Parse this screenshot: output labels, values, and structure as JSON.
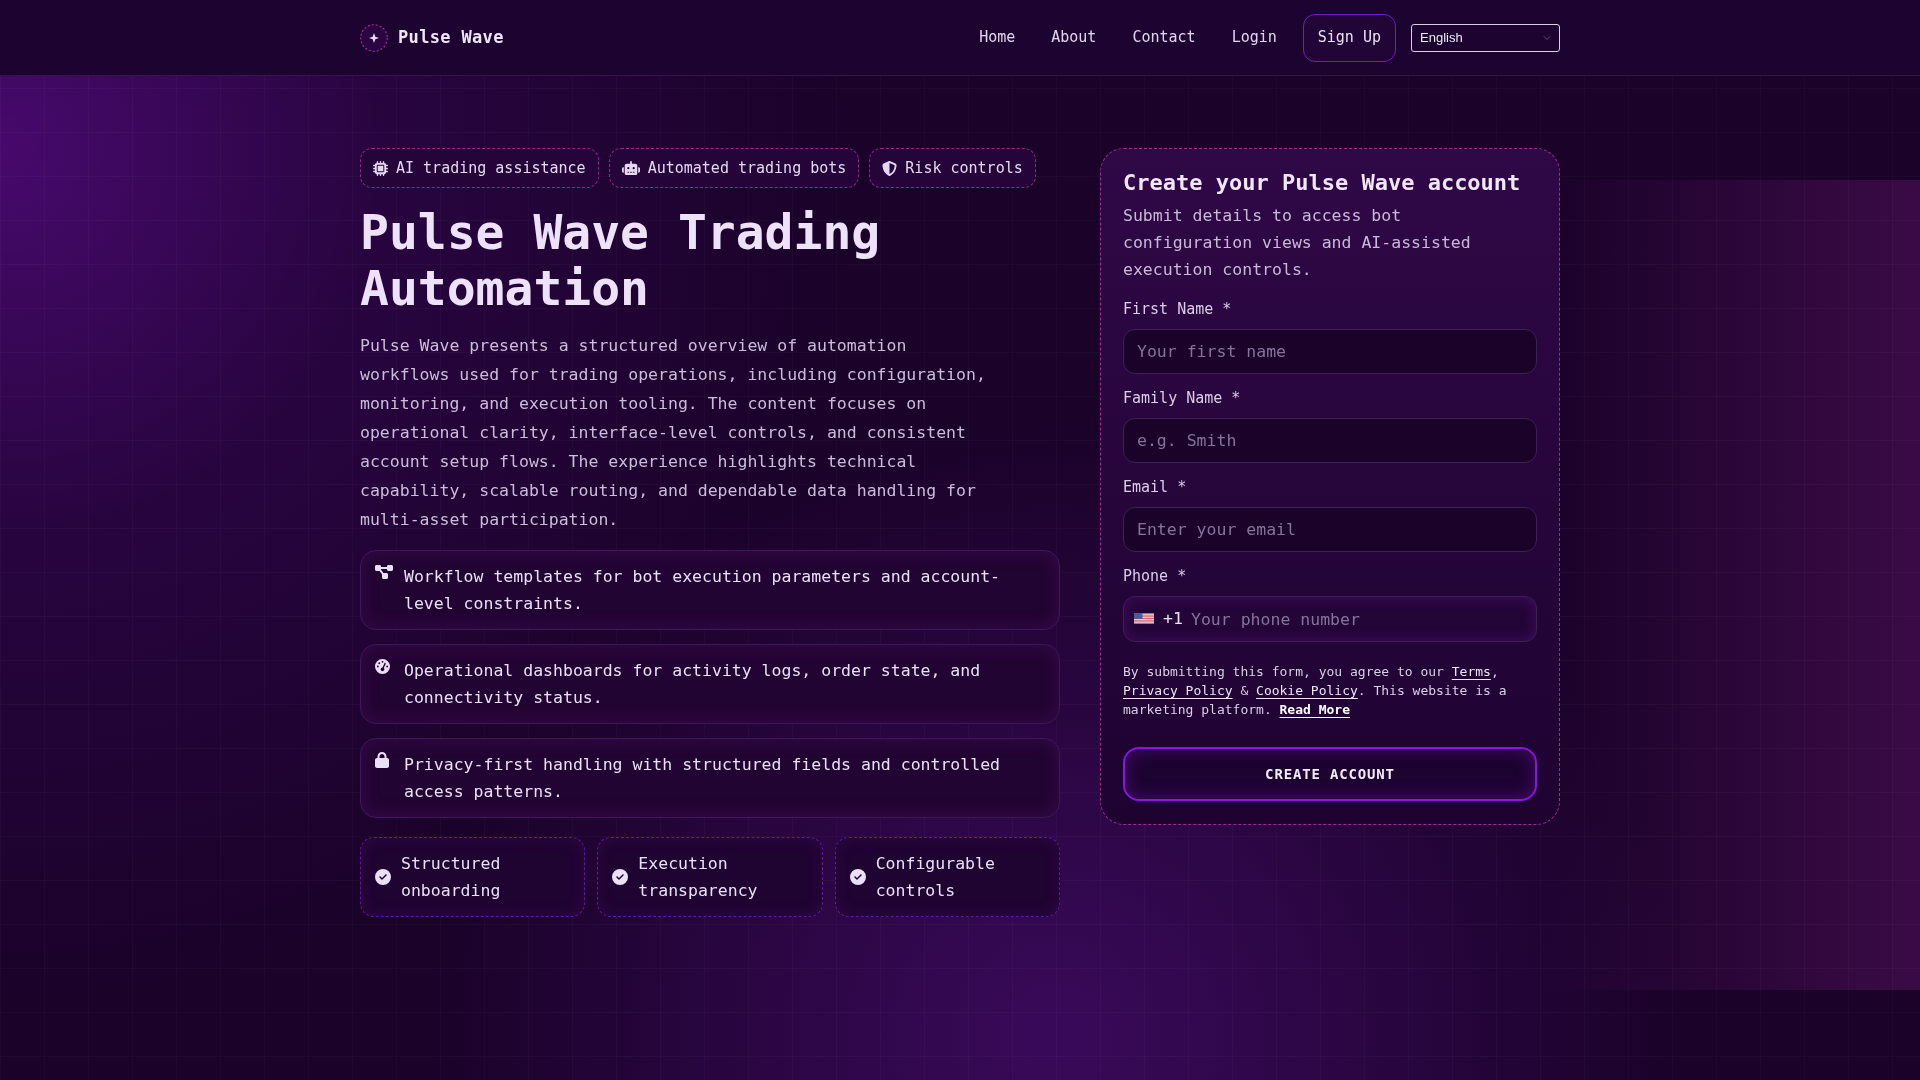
{
  "header": {
    "brand": "Pulse Wave",
    "nav": [
      {
        "label": "Home"
      },
      {
        "label": "About"
      },
      {
        "label": "Contact"
      },
      {
        "label": "Login"
      }
    ],
    "sign_up": "Sign Up",
    "language": "English"
  },
  "hero": {
    "badges": [
      {
        "kind": "ai",
        "label": "AI trading assistance"
      },
      {
        "kind": "bots",
        "label": "Automated trading bots"
      },
      {
        "kind": "risk",
        "label": "Risk controls"
      }
    ],
    "title": "Pulse Wave Trading Automation",
    "description": "Pulse Wave presents a structured overview of automation workflows used for trading operations, including configuration, monitoring, and execution tooling. The content focuses on operational clarity, interface-level controls, and consistent account setup flows. The experience highlights technical capability, scalable routing, and dependable data handling for multi-asset participation.",
    "features": [
      {
        "kind": "workflow",
        "text": "Workflow templates for bot execution parameters and account-level constraints."
      },
      {
        "kind": "dashboard",
        "text": "Operational dashboards for activity logs, order state, and connectivity status."
      },
      {
        "kind": "privacy",
        "text": "Privacy-first handling with structured fields and controlled access patterns."
      }
    ],
    "highlights": [
      {
        "label": "Structured onboarding"
      },
      {
        "label": "Execution transparency"
      },
      {
        "label": "Configurable controls"
      }
    ]
  },
  "signup_form": {
    "title": "Create your Pulse Wave account",
    "subtitle": "Submit details to access bot configuration views and AI-assisted execution controls.",
    "fields": [
      {
        "kind": "text",
        "label": "First Name *",
        "placeholder": "Your first name"
      },
      {
        "kind": "text",
        "label": "Family Name *",
        "placeholder": "e.g. Smith"
      },
      {
        "kind": "email",
        "label": "Email *",
        "placeholder": "Enter your email"
      },
      {
        "kind": "phone",
        "label": "Phone *",
        "prefix": "+1",
        "placeholder": "Your phone number"
      }
    ],
    "consent": [
      {
        "kind": "text",
        "text": "By submitting this form, you agree to our "
      },
      {
        "kind": "link",
        "text": "Terms"
      },
      {
        "kind": "text",
        "text": ", "
      },
      {
        "kind": "link",
        "text": "Privacy Policy"
      },
      {
        "kind": "text",
        "text": " & "
      },
      {
        "kind": "link",
        "text": "Cookie Policy"
      },
      {
        "kind": "text",
        "text": ". This website is a marketing platform. "
      },
      {
        "kind": "strong_link",
        "text": "Read More"
      }
    ],
    "submit": "CREATE ACCOUNT"
  }
}
